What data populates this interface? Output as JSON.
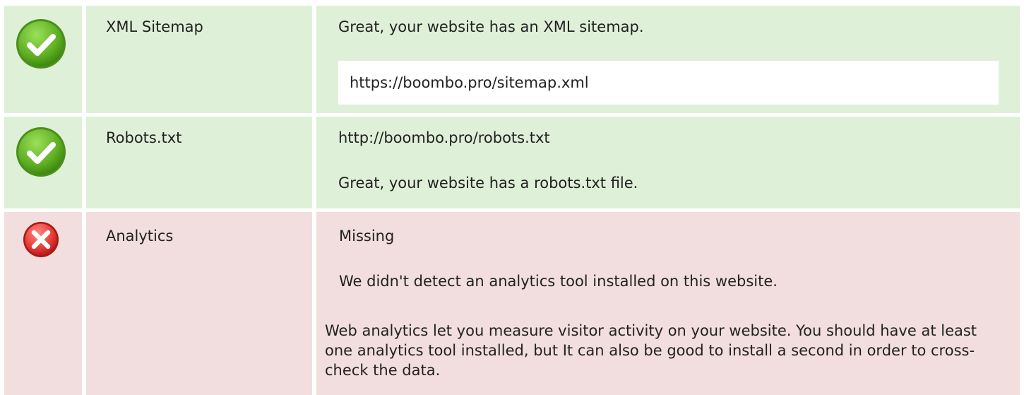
{
  "rows": [
    {
      "status": "pass",
      "icon": "check-circle-icon",
      "name": "XML Sitemap",
      "message": "Great, your website has an XML sitemap.",
      "url": "https://boombo.pro/sitemap.xml"
    },
    {
      "status": "pass",
      "icon": "check-circle-icon",
      "name": "Robots.txt",
      "url": "http://boombo.pro/robots.txt",
      "message": "Great, your website has a robots.txt file."
    },
    {
      "status": "fail",
      "icon": "x-circle-icon",
      "name": "Analytics",
      "status_text": "Missing",
      "message": "We didn't detect an analytics tool installed on this website.",
      "description": "Web analytics let you measure visitor activity on your website. You should have at least one analytics tool installed, but It can also be good to install a second in order to cross-check the data."
    }
  ],
  "colors": {
    "pass_bg": "#dff0d8",
    "fail_bg": "#f2dede",
    "pass_icon": "#6fbf2a",
    "fail_icon": "#e53935"
  }
}
